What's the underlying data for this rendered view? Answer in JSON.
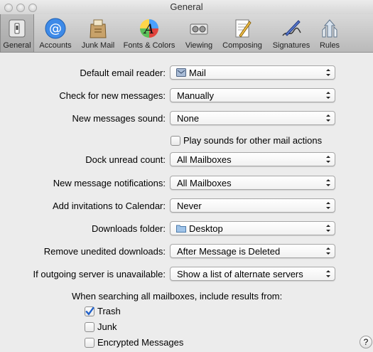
{
  "window": {
    "title": "General"
  },
  "toolbar": {
    "items": [
      {
        "label": "General",
        "icon": "general-icon",
        "selected": true
      },
      {
        "label": "Accounts",
        "icon": "accounts-icon"
      },
      {
        "label": "Junk Mail",
        "icon": "junk-mail-icon"
      },
      {
        "label": "Fonts & Colors",
        "icon": "fonts-colors-icon"
      },
      {
        "label": "Viewing",
        "icon": "viewing-icon"
      },
      {
        "label": "Composing",
        "icon": "composing-icon"
      },
      {
        "label": "Signatures",
        "icon": "signatures-icon"
      },
      {
        "label": "Rules",
        "icon": "rules-icon"
      }
    ]
  },
  "settings": {
    "default_reader": {
      "label": "Default email reader:",
      "value": "Mail",
      "icon": "mail-app-icon"
    },
    "check_messages": {
      "label": "Check for new messages:",
      "value": "Manually"
    },
    "sound": {
      "label": "New messages sound:",
      "value": "None"
    },
    "play_sounds": {
      "label": "Play sounds for other mail actions",
      "checked": false
    },
    "dock_count": {
      "label": "Dock unread count:",
      "value": "All Mailboxes"
    },
    "notifications": {
      "label": "New message notifications:",
      "value": "All Mailboxes"
    },
    "invitations": {
      "label": "Add invitations to Calendar:",
      "value": "Never"
    },
    "downloads_folder": {
      "label": "Downloads folder:",
      "value": "Desktop",
      "icon": "folder-icon"
    },
    "remove_downloads": {
      "label": "Remove unedited downloads:",
      "value": "After Message is Deleted"
    },
    "outgoing": {
      "label": "If outgoing server is unavailable:",
      "value": "Show a list of alternate servers"
    }
  },
  "search": {
    "heading": "When searching all mailboxes, include results from:",
    "options": [
      {
        "label": "Trash",
        "checked": true
      },
      {
        "label": "Junk",
        "checked": false
      },
      {
        "label": "Encrypted Messages",
        "checked": false
      }
    ]
  },
  "help": {
    "label": "?"
  },
  "colors": {
    "accent_check": "#1e5fc8",
    "window_bg": "#ececec"
  }
}
